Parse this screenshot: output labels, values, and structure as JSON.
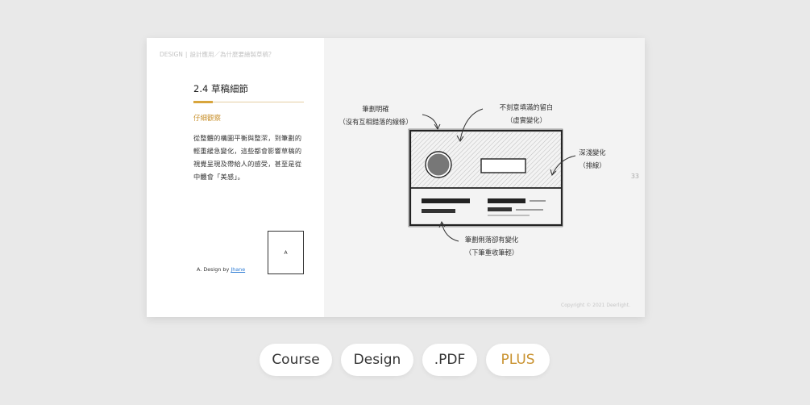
{
  "slide": {
    "breadcrumb": {
      "brand": "DESIGN",
      "separator": "|",
      "path": "設計應用／為什麼要繪製草稿？"
    },
    "title": "2.4 草稿細節",
    "subtitle": "仔細觀察",
    "body": "從整體的構圖平衡與整潔，到筆劃的輕重緩急變化，這些都會影響草稿的視覺呈現及帶給人的感受，甚至是從中體會「美感」。",
    "credit": {
      "prefix": "A. Design by",
      "author": "Jhane"
    },
    "thumbnail_label": "A",
    "annotations": {
      "stroke_clear_1": "筆劃明確",
      "stroke_clear_2": "（沒有互相錯落的線條）",
      "whitespace_1": "不刻意填滿的留白",
      "whitespace_2": "（虛實變化）",
      "shading_1": "深淺變化",
      "shading_2": "（排線）",
      "stroke_vary_1": "筆劃俐落卻有變化",
      "stroke_vary_2": "（下筆重收筆輕）"
    },
    "page_number": "33",
    "copyright": "Copyright © 2021 Deerlight."
  },
  "tags": [
    {
      "label": "Course"
    },
    {
      "label": "Design"
    },
    {
      "label": ".PDF"
    },
    {
      "label": "PLUS"
    }
  ],
  "colors": {
    "accent": "#c9922f",
    "background": "#e9e9e9",
    "link": "#2c7bd4"
  }
}
